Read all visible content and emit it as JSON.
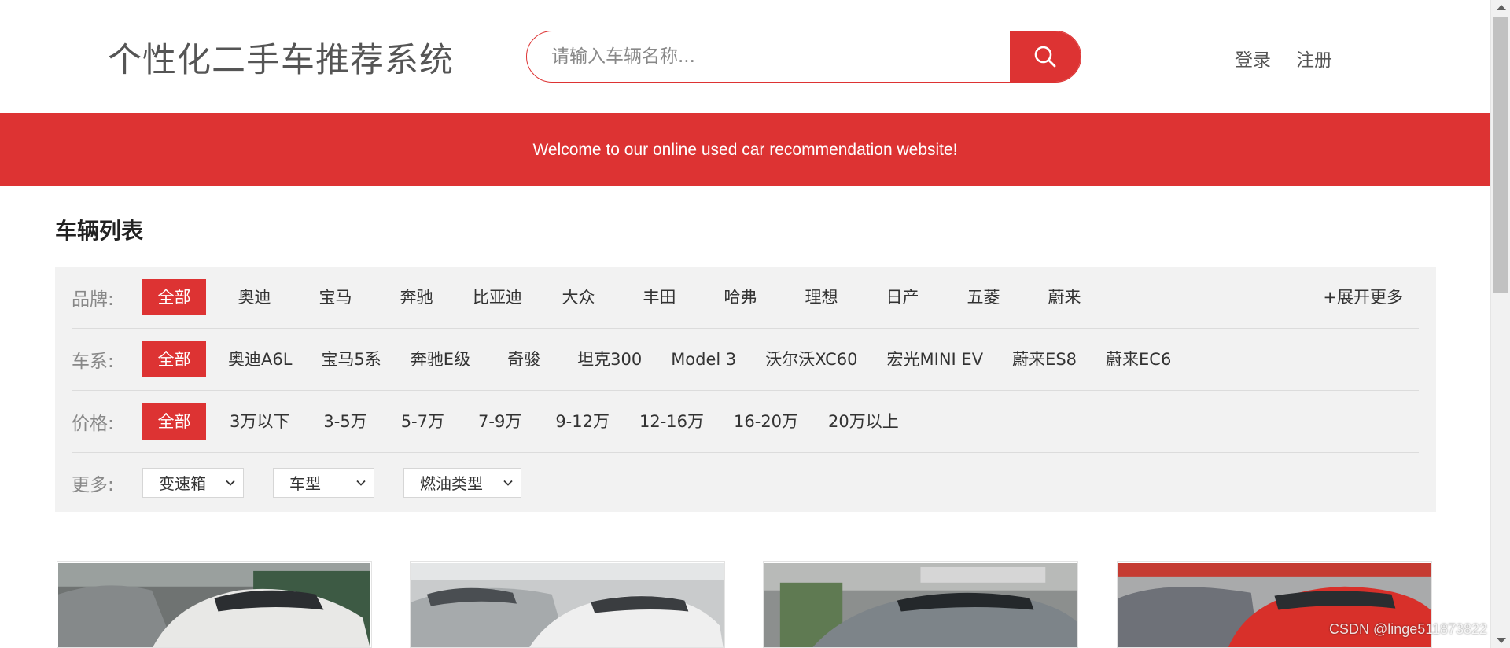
{
  "header": {
    "site_title": "个性化二手车推荐系统",
    "search_placeholder": "请输入车辆名称...",
    "search_icon": "search-icon",
    "login": "登录",
    "register": "注册"
  },
  "banner": {
    "text": "Welcome to our online used car recommendation website!"
  },
  "section_title": "车辆列表",
  "filters": {
    "brand": {
      "label": "品牌:",
      "options": [
        "全部",
        "奥迪",
        "宝马",
        "奔驰",
        "比亚迪",
        "大众",
        "丰田",
        "哈弗",
        "理想",
        "日产",
        "五菱",
        "蔚来"
      ],
      "selected": "全部",
      "expand": "+展开更多"
    },
    "series": {
      "label": "车系:",
      "options": [
        "全部",
        "奥迪A6L",
        "宝马5系",
        "奔驰E级",
        "奇骏",
        "坦克300",
        "Model 3",
        "沃尔沃XC60",
        "宏光MINI EV",
        "蔚来ES8",
        "蔚来EC6"
      ],
      "selected": "全部"
    },
    "price": {
      "label": "价格:",
      "options": [
        "全部",
        "3万以下",
        "3-5万",
        "5-7万",
        "7-9万",
        "9-12万",
        "12-16万",
        "16-20万",
        "20万以上"
      ],
      "selected": "全部"
    },
    "more": {
      "label": "更多:",
      "selects": [
        "变速箱",
        "车型",
        "燃油类型"
      ]
    }
  },
  "watermark": "CSDN @linge511873822",
  "colors": {
    "accent": "#dd3333",
    "panel": "#f2f2f2"
  }
}
